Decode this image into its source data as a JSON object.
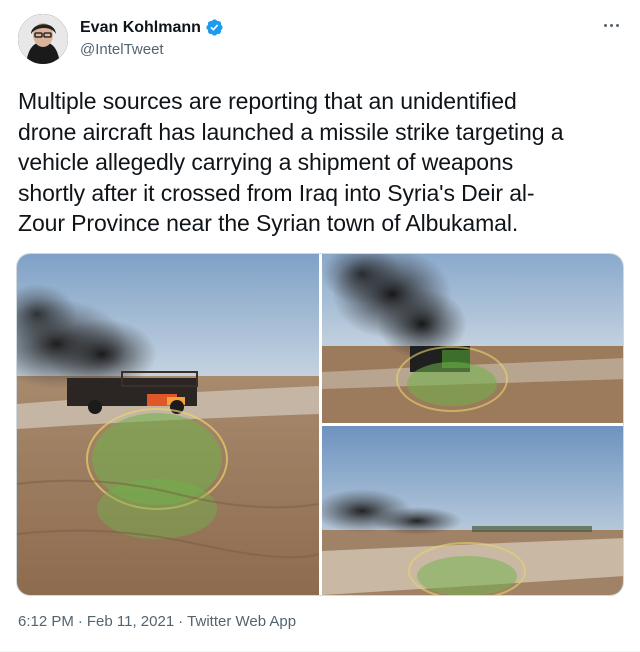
{
  "author": {
    "display_name": "Evan Kohlmann",
    "handle": "@IntelTweet",
    "verified": true
  },
  "tweet": {
    "lines": [
      "Multiple sources are reporting that an unidentified",
      "drone aircraft has launched a missile strike targeting a",
      "vehicle allegedly carrying a shipment of weapons",
      "shortly after it crossed from Iraq into Syria's Deir al-",
      "Zour Province near the Syrian town of Albukamal."
    ],
    "time": "6:12 PM",
    "date": "Feb 11, 2021",
    "source": "Twitter Web App",
    "separator": "·"
  },
  "media": {
    "photo_count": 3
  },
  "icons": {
    "more": "more-horizontal-icon",
    "verified": "verified-badge-icon"
  },
  "colors": {
    "accent": "#1d9bf0",
    "text": "#0f1419",
    "secondary": "#536471"
  }
}
